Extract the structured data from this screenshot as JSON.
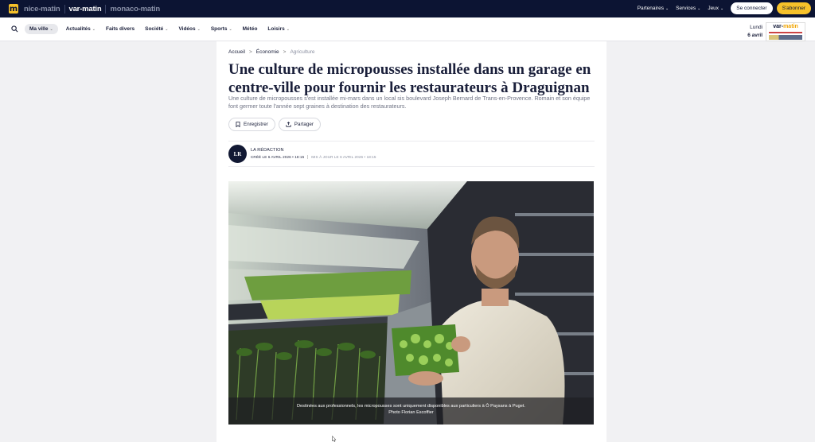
{
  "brands": [
    {
      "label": "nice-matin",
      "active": false
    },
    {
      "label": "var-matin",
      "active": true
    },
    {
      "label": "monaco-matin",
      "active": false
    }
  ],
  "topnav": {
    "partners": "Partenaires",
    "services": "Services",
    "games": "Jeux",
    "login": "Se connecter",
    "subscribe": "S'abonner"
  },
  "nav": {
    "items": [
      "Ma ville",
      "Actualités",
      "Faits divers",
      "Société",
      "Vidéos",
      "Sports",
      "Météo",
      "Loisirs"
    ],
    "date_day": "Lundi",
    "date_full": "6 avril",
    "paper_title_a": "var-",
    "paper_title_b": "matin"
  },
  "breadcrumb": [
    "Accueil",
    "Économie",
    "Agriculture"
  ],
  "breadcrumb_sep": ">",
  "article": {
    "title": "Une culture de micropousses installée dans un garage en centre-ville pour fournir les restaurateurs à Draguignan",
    "lede": "Une culture de micropousses s'est installée mi-mars dans un local sis boulevard Joseph Bernard de Trans-en-Provence. Romain et son équipe font germer toute l'année sept graines à destination des restaurateurs.",
    "save_label": "Enregistrer",
    "share_label": "Partager"
  },
  "author": {
    "initials": "LR",
    "name": "LA RÉDACTION",
    "created": "CRÉÉ LE 6 AVRIL 2026 • 18:15",
    "updated": "MIS À JOUR LE 6 AVRIL 2026 • 18:15"
  },
  "photo": {
    "caption": "Destinées aux professionnels, les micropousses sont uniquement disponibles aux particuliers à Ô Paysans à Puget.",
    "credit": "Photo Florian Escoffier"
  },
  "colors": {
    "topbar": "#0c1433",
    "accent": "#f6c12a",
    "text": "#1a1f3a"
  }
}
